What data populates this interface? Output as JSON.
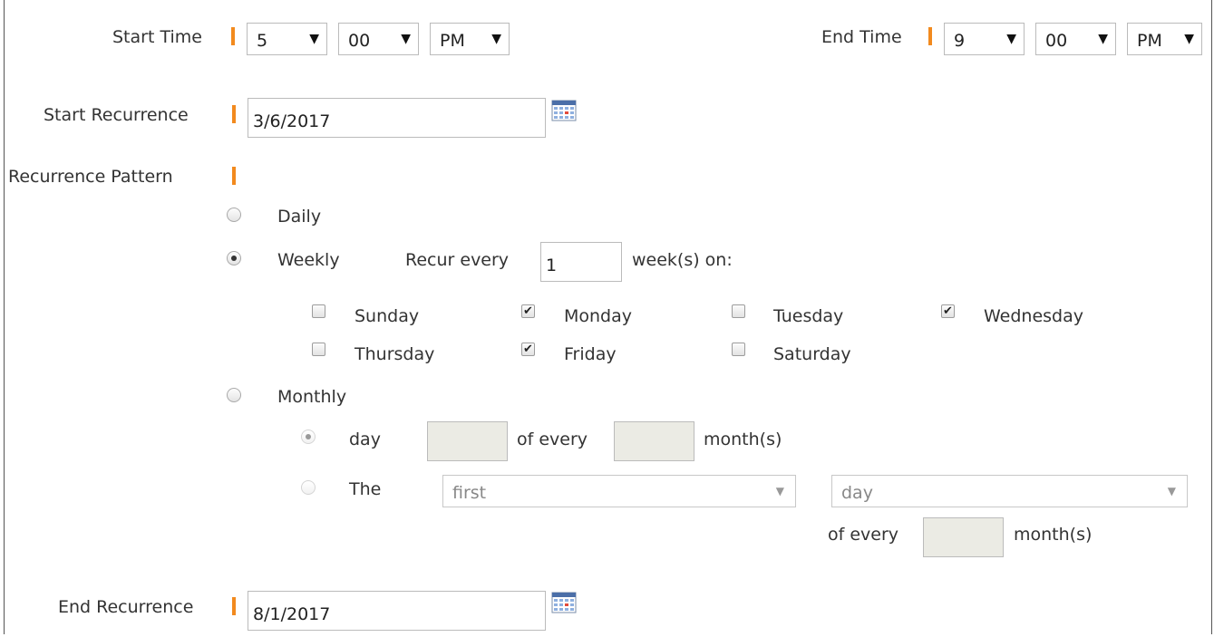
{
  "start_time": {
    "label": "Start Time",
    "hour": "5",
    "minute": "00",
    "ampm": "PM"
  },
  "end_time": {
    "label": "End Time",
    "hour": "9",
    "minute": "00",
    "ampm": "PM"
  },
  "start_recurrence": {
    "label": "Start Recurrence",
    "value": "3/6/2017"
  },
  "end_recurrence": {
    "label": "End Recurrence",
    "value": "8/1/2017"
  },
  "pattern": {
    "label": "Recurrence Pattern",
    "daily_label": "Daily",
    "weekly_label": "Weekly",
    "monthly_label": "Monthly",
    "selected": "weekly"
  },
  "weekly": {
    "recur_every_label": "Recur every",
    "recur_every_value": "1",
    "weeks_on_label": "week(s) on:",
    "days": [
      {
        "label": "Sunday",
        "checked": false
      },
      {
        "label": "Monday",
        "checked": true
      },
      {
        "label": "Tuesday",
        "checked": false
      },
      {
        "label": "Wednesday",
        "checked": true
      },
      {
        "label": "Thursday",
        "checked": false
      },
      {
        "label": "Friday",
        "checked": true
      },
      {
        "label": "Saturday",
        "checked": false
      }
    ]
  },
  "monthly": {
    "day_label": "day",
    "of_every_label": "of every",
    "months_label": "month(s)",
    "day_value": "",
    "every_value": "",
    "the_label": "The",
    "ordinal_value": "first",
    "weekday_value": "day",
    "of_every_label2": "of every",
    "every_value2": "",
    "months_label2": "month(s)"
  },
  "icons": {
    "calendar": "calendar-icon",
    "dropdown": "▼"
  },
  "colors": {
    "required_marker": "#f28a1e",
    "disabled_input": "#ebebe4"
  }
}
